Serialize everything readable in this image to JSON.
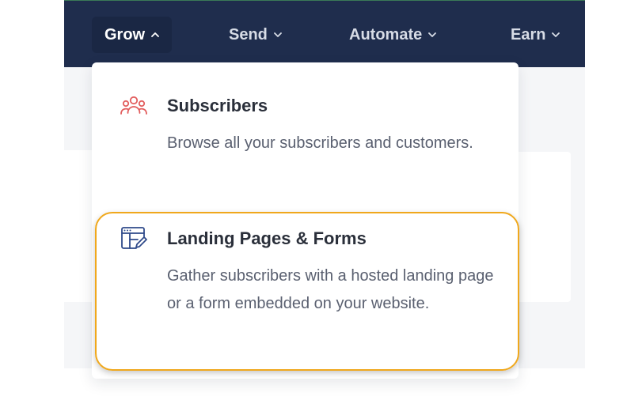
{
  "nav": {
    "items": [
      {
        "label": "Grow",
        "state": "open"
      },
      {
        "label": "Send",
        "state": "closed"
      },
      {
        "label": "Automate",
        "state": "closed"
      },
      {
        "label": "Earn",
        "state": "closed"
      }
    ]
  },
  "dropdown": {
    "items": [
      {
        "icon": "users-icon",
        "title": "Subscribers",
        "description": "Browse all your subscribers and customers."
      },
      {
        "icon": "landing-page-form-icon",
        "title": "Landing Pages & Forms",
        "description": "Gather subscribers with a hosted landing page or a form embedded on your website."
      }
    ]
  },
  "colors": {
    "nav_background": "#1f2d4d",
    "highlight_border": "#f0a81c",
    "subscribers_icon": "#e25d5d",
    "landing_icon": "#2f4a8a"
  }
}
